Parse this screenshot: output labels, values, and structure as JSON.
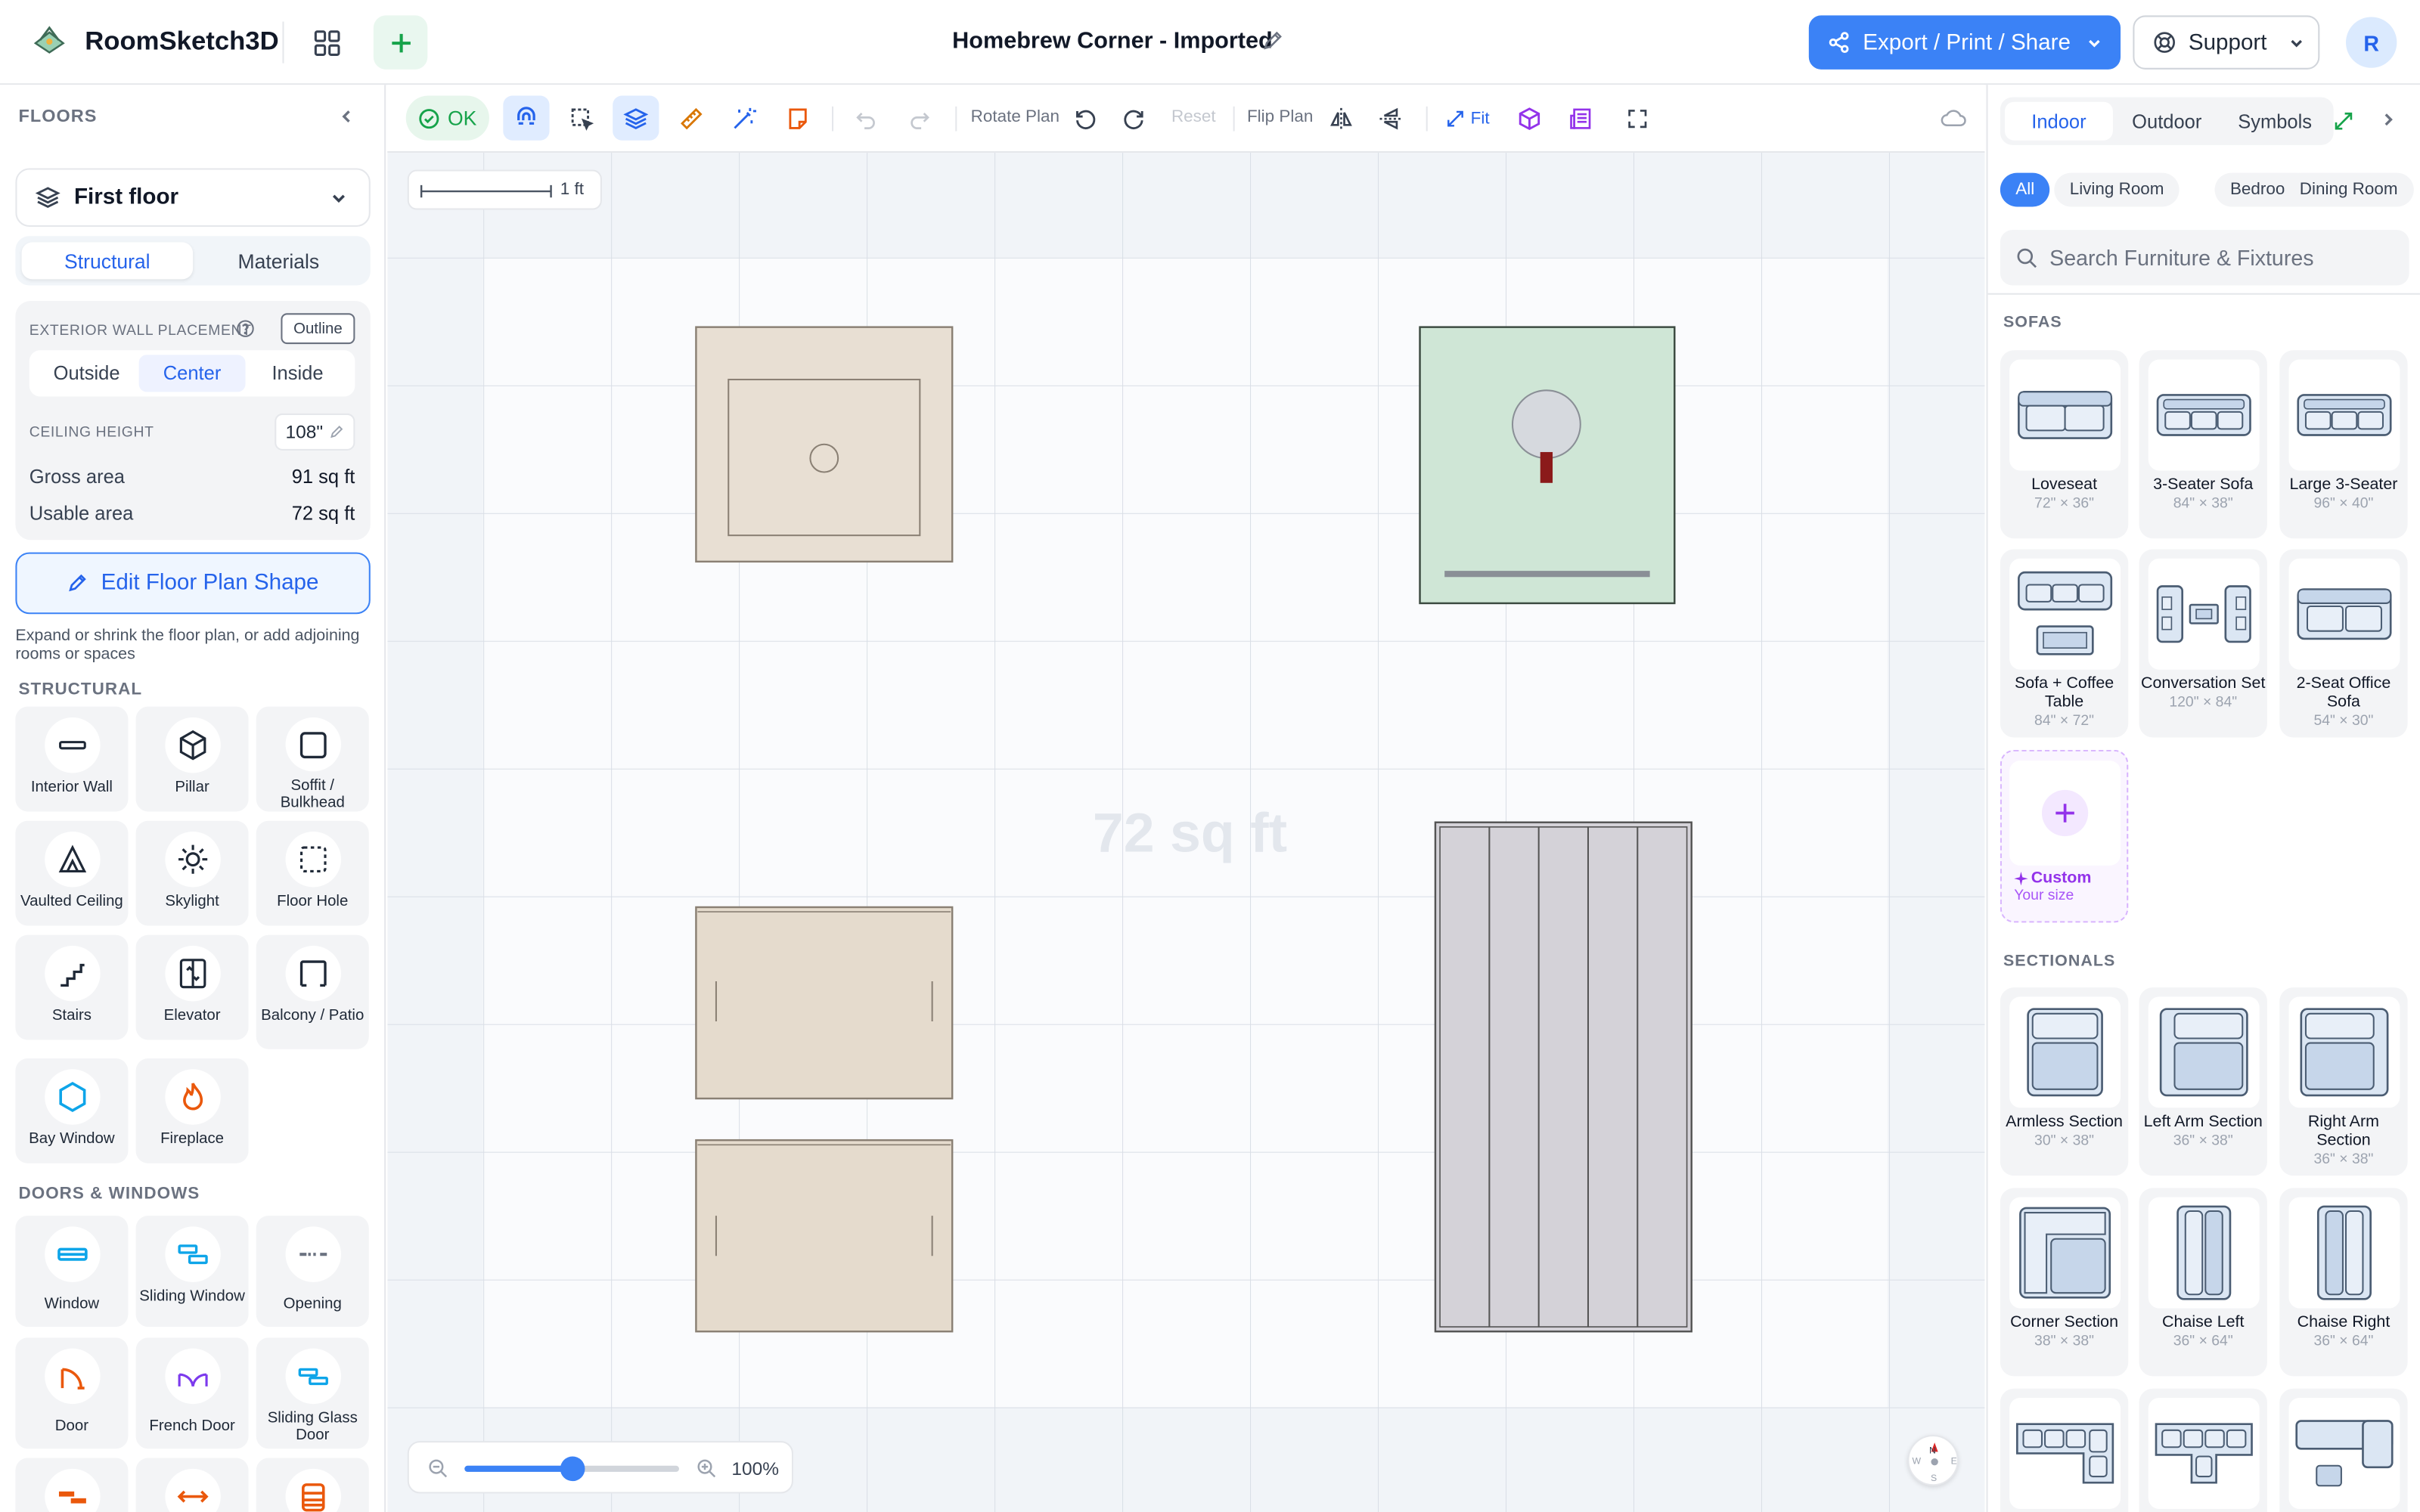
{
  "app": {
    "name": "RoomSketch3D",
    "title": "Homebrew Corner - Imported"
  },
  "topbar": {
    "export_label": "Export / Print / Share",
    "support_label": "Support",
    "avatar_initial": "R"
  },
  "floors": {
    "heading": "FLOORS",
    "selected_floor": "First floor",
    "tabs": [
      "Structural",
      "Materials"
    ],
    "active_tab": "Structural",
    "wall_placement_label": "EXTERIOR WALL PLACEMENT",
    "outline_label": "Outline",
    "placement_options": [
      "Outside",
      "Center",
      "Inside"
    ],
    "placement_selected": "Center",
    "ceiling_label": "CEILING HEIGHT",
    "ceiling_value": "108\"",
    "gross_label": "Gross area",
    "gross_value": "91 sq ft",
    "usable_label": "Usable area",
    "usable_value": "72 sq ft",
    "edit_button": "Edit Floor Plan Shape",
    "edit_hint": "Expand or shrink the floor plan, or add adjoining rooms or spaces"
  },
  "structural": {
    "heading": "STRUCTURAL",
    "items": [
      {
        "label": "Interior Wall",
        "icon": "interior-wall-icon"
      },
      {
        "label": "Pillar",
        "icon": "pillar-icon"
      },
      {
        "label": "Soffit / Bulkhead",
        "icon": "soffit-icon"
      },
      {
        "label": "Vaulted Ceiling",
        "icon": "vaulted-ceiling-icon"
      },
      {
        "label": "Skylight",
        "icon": "skylight-icon"
      },
      {
        "label": "Floor Hole",
        "icon": "floor-hole-icon"
      },
      {
        "label": "Stairs",
        "icon": "stairs-icon"
      },
      {
        "label": "Elevator",
        "icon": "elevator-icon"
      },
      {
        "label": "Balcony / Patio",
        "icon": "balcony-icon"
      },
      {
        "label": "Bay Window",
        "icon": "bay-window-icon"
      },
      {
        "label": "Fireplace",
        "icon": "fireplace-icon"
      }
    ]
  },
  "doors_windows": {
    "heading": "DOORS & WINDOWS",
    "items": [
      {
        "label": "Window",
        "icon": "window-icon"
      },
      {
        "label": "Sliding Window",
        "icon": "sliding-window-icon"
      },
      {
        "label": "Opening",
        "icon": "opening-icon"
      },
      {
        "label": "Door",
        "icon": "door-icon"
      },
      {
        "label": "French Door",
        "icon": "french-door-icon"
      },
      {
        "label": "Sliding Glass Door",
        "icon": "sliding-glass-door-icon"
      }
    ]
  },
  "toolbar": {
    "status": "OK",
    "rotate_label": "Rotate Plan",
    "reset_label": "Reset",
    "flip_label": "Flip Plan",
    "fit_label": "Fit"
  },
  "canvas": {
    "area_label": "72 sq ft",
    "scale_label": "1 ft",
    "zoom_label": "100%",
    "zoom_level": 0.5,
    "compass": {
      "n": "N",
      "e": "E",
      "s": "S",
      "w": "W"
    }
  },
  "catalog": {
    "tabs": [
      "Indoor",
      "Outdoor",
      "Symbols"
    ],
    "active_tab": "Indoor",
    "chips": [
      "All",
      "Living Room",
      "Bedroom",
      "Dining Room"
    ],
    "active_chip": "All",
    "search_placeholder": "Search Furniture & Fixtures",
    "sofas_heading": "SOFAS",
    "sofas": [
      {
        "name": "Loveseat",
        "dims": "72\" × 36\""
      },
      {
        "name": "3-Seater Sofa",
        "dims": "84\" × 38\""
      },
      {
        "name": "Large 3-Seater",
        "dims": "96\" × 40\""
      },
      {
        "name": "Sofa + Coffee Table",
        "dims": "84\" × 72\""
      },
      {
        "name": "Conversation Set",
        "dims": "120\" × 84\""
      },
      {
        "name": "2-Seat Office Sofa",
        "dims": "54\" × 30\""
      }
    ],
    "custom": {
      "name": "Custom",
      "sub": "Your size"
    },
    "sectionals_heading": "SECTIONALS",
    "sectionals": [
      {
        "name": "Armless Section",
        "dims": "30\" × 38\""
      },
      {
        "name": "Left Arm Section",
        "dims": "36\" × 38\""
      },
      {
        "name": "Right Arm Section",
        "dims": "36\" × 38\""
      },
      {
        "name": "Corner Section",
        "dims": "38\" × 38\""
      },
      {
        "name": "Chaise Left",
        "dims": "36\" × 64\""
      },
      {
        "name": "Chaise Right",
        "dims": "36\" × 64\""
      }
    ]
  },
  "colors": {
    "accent": "#3b82f6",
    "ok": "#16a34a",
    "purple": "#9333ea"
  }
}
